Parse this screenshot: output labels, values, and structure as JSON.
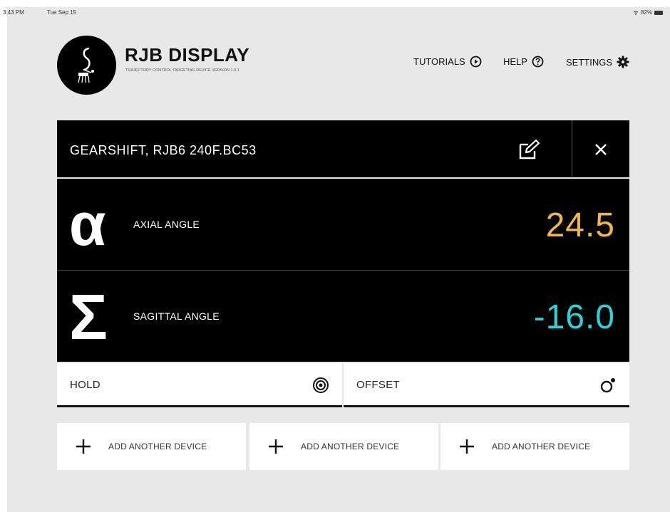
{
  "status_bar": {
    "time": "3:43 PM",
    "date": "Tue Sep 15",
    "battery": "82%"
  },
  "brand": {
    "title": "RJB DISPLAY",
    "subtitle": "TRAJECTORY CONTROL TARGETING DEVICE VERSION 1.0.1"
  },
  "nav": {
    "tutorials": "TUTORIALS",
    "help": "HELP",
    "settings": "SETTINGS"
  },
  "device": {
    "name": "GEARSHIFT, RJB6 240F.BC53"
  },
  "axial": {
    "symbol": "α",
    "label": "AXIAL ANGLE",
    "value": "24.5",
    "color": "#f0b84a"
  },
  "sagittal": {
    "symbol": "Σ",
    "label": "SAGITTAL ANGLE",
    "value": "-16.0",
    "color": "#29d3d8"
  },
  "controls": {
    "hold": "HOLD",
    "offset": "OFFSET"
  },
  "add_device": [
    "ADD ANOTHER DEVICE",
    "ADD ANOTHER DEVICE",
    "ADD ANOTHER DEVICE"
  ],
  "icons": {
    "tutorials": "play-circle-icon",
    "help": "question-circle-icon",
    "settings": "gear-icon",
    "edit": "edit-icon",
    "close": "close-icon",
    "hold": "target-icon",
    "offset": "offset-icon",
    "add": "plus-icon"
  }
}
